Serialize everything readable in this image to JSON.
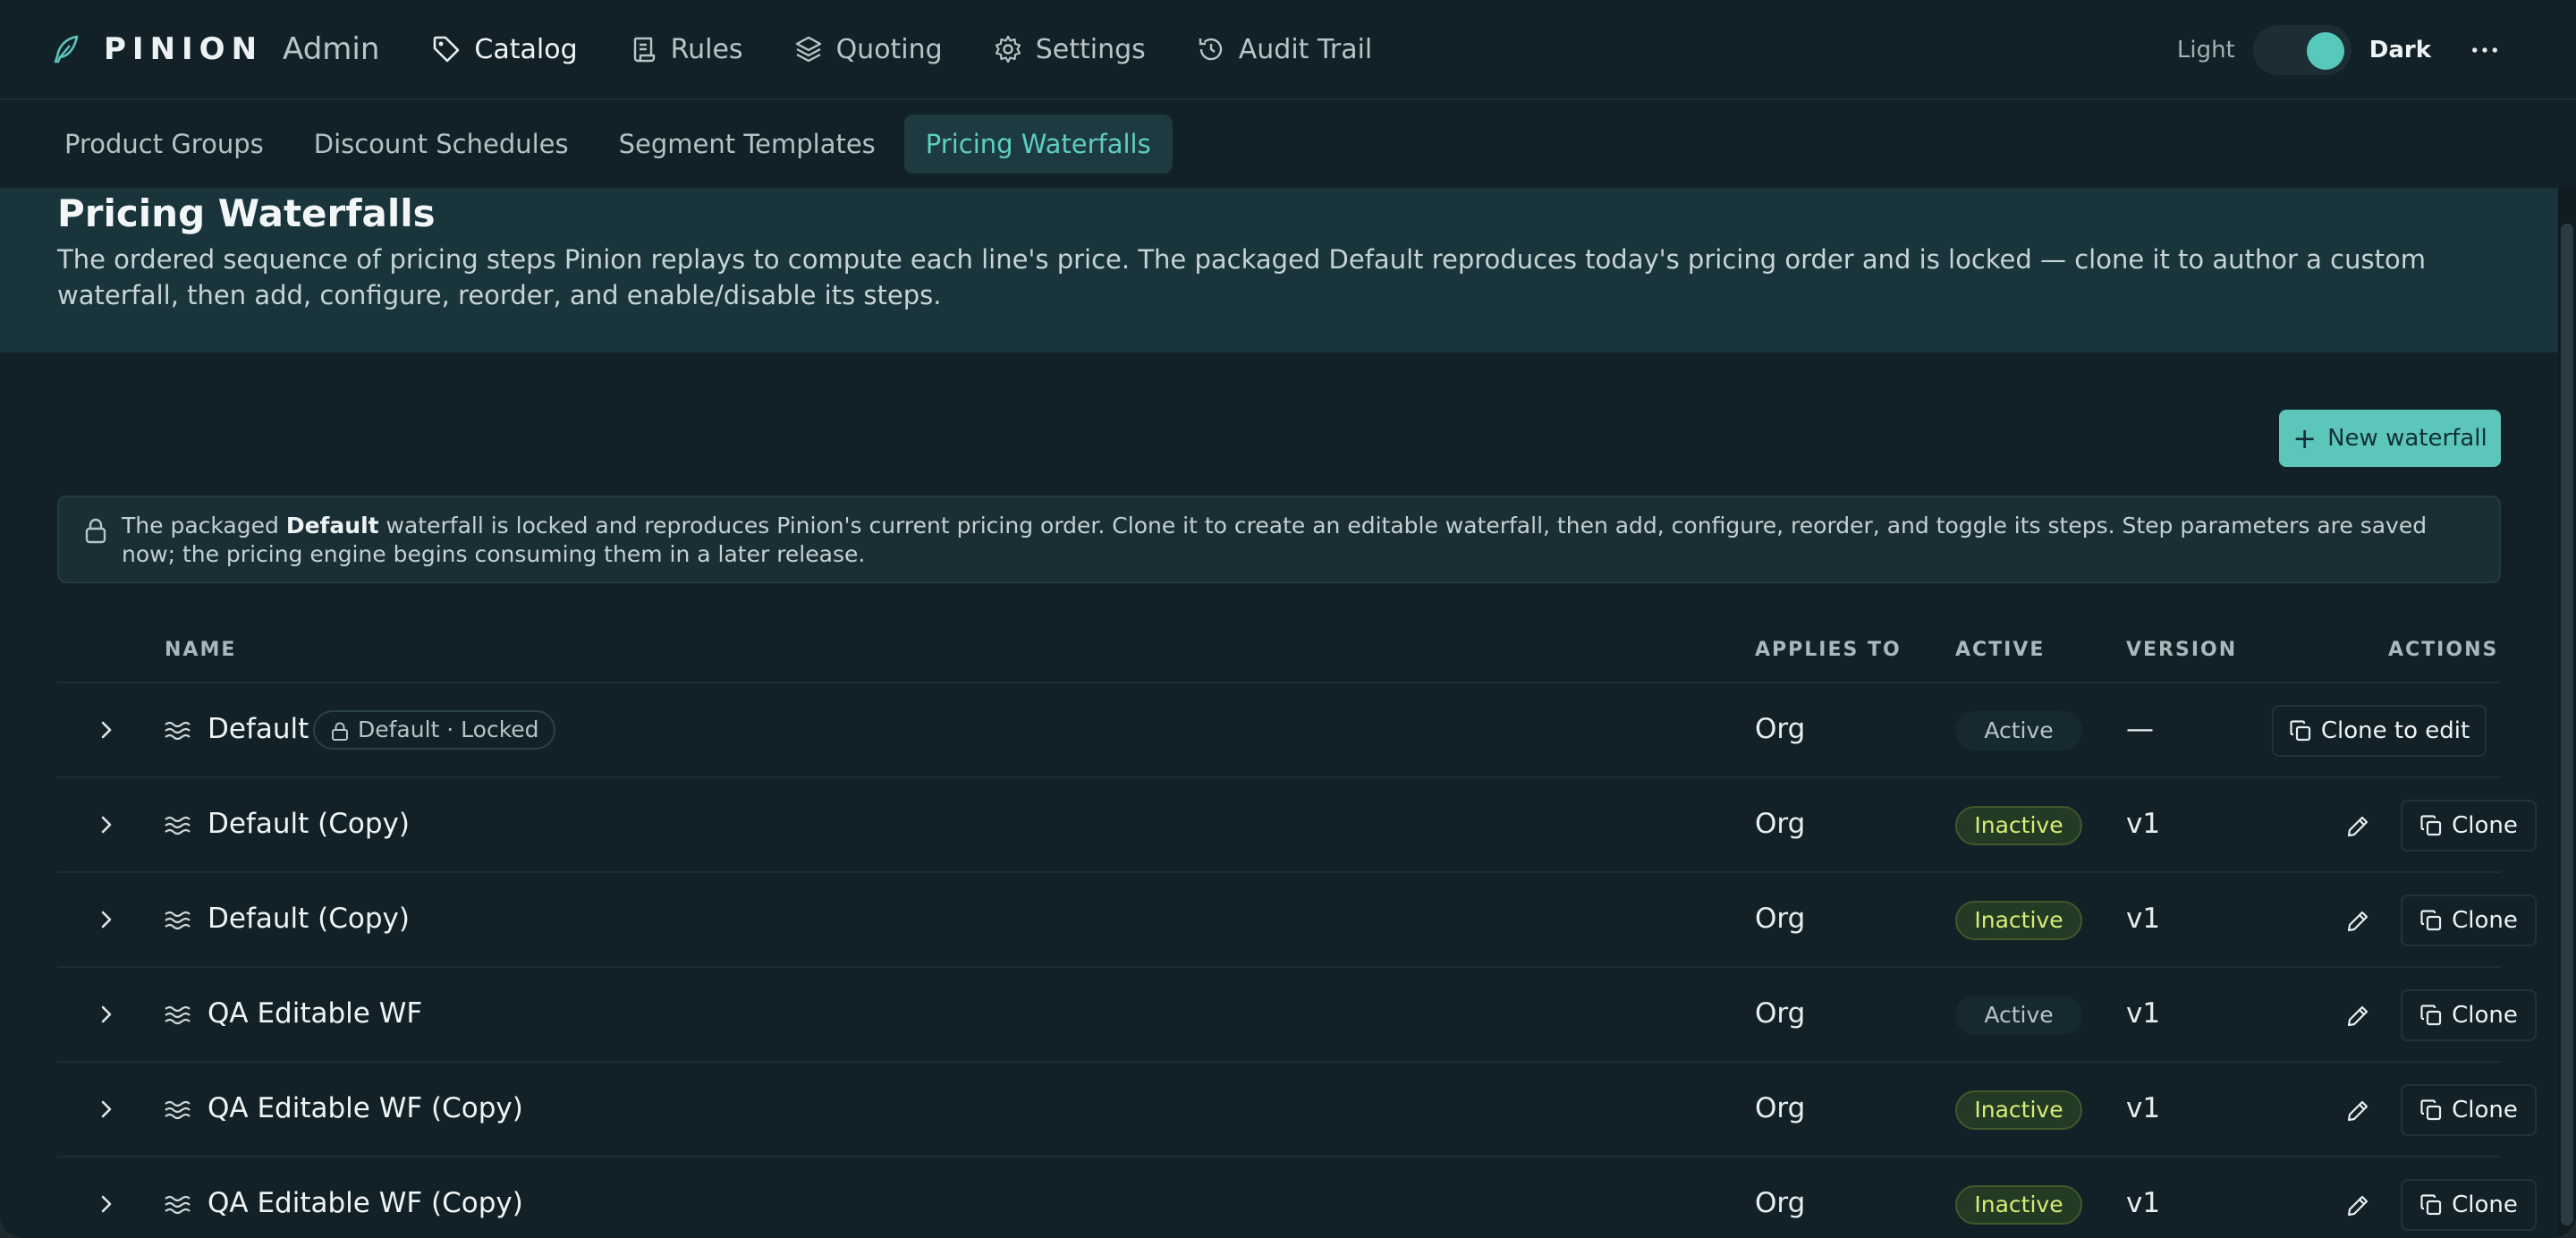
{
  "app": {
    "brand": "PINION",
    "brand_sub": "Admin",
    "nav": [
      {
        "label": "Catalog",
        "icon": "tag-icon",
        "active": true
      },
      {
        "label": "Rules",
        "icon": "scroll-icon"
      },
      {
        "label": "Quoting",
        "icon": "layers-icon"
      },
      {
        "label": "Settings",
        "icon": "gear-icon"
      },
      {
        "label": "Audit Trail",
        "icon": "history-icon"
      }
    ],
    "theme": {
      "light_label": "Light",
      "dark_label": "Dark",
      "selected": "Dark"
    }
  },
  "subtabs": [
    {
      "label": "Product Groups"
    },
    {
      "label": "Discount Schedules"
    },
    {
      "label": "Segment Templates"
    },
    {
      "label": "Pricing Waterfalls",
      "active": true
    }
  ],
  "page": {
    "title": "Pricing Waterfalls",
    "description": "The ordered sequence of pricing steps Pinion replays to compute each line's price. The packaged Default reproduces today's pricing order and is locked — clone it to author a custom waterfall, then add, configure, reorder, and enable/disable its steps.",
    "new_button": "New waterfall",
    "notice": {
      "before": "The packaged ",
      "bold": "Default",
      "after": " waterfall is locked and reproduces Pinion's current pricing order. Clone it to create an editable waterfall, then add, configure, reorder, and toggle its steps. Step parameters are saved now; the pricing engine begins consuming them in a later release."
    }
  },
  "table": {
    "headers": {
      "name": "NAME",
      "applies_to": "APPLIES TO",
      "active": "ACTIVE",
      "version": "VERSION",
      "actions": "ACTIONS"
    },
    "rows": [
      {
        "name": "Default",
        "badge": "Default · Locked",
        "applies_to": "Org",
        "status": "Active",
        "version": "—",
        "action": "Clone to edit",
        "locked": true
      },
      {
        "name": "Default (Copy)",
        "applies_to": "Org",
        "status": "Inactive",
        "version": "v1",
        "action": "Clone"
      },
      {
        "name": "Default (Copy)",
        "applies_to": "Org",
        "status": "Inactive",
        "version": "v1",
        "action": "Clone"
      },
      {
        "name": "QA Editable WF",
        "applies_to": "Org",
        "status": "Active",
        "version": "v1",
        "action": "Clone"
      },
      {
        "name": "QA Editable WF (Copy)",
        "applies_to": "Org",
        "status": "Inactive",
        "version": "v1",
        "action": "Clone"
      },
      {
        "name": "QA Editable WF (Copy)",
        "applies_to": "Org",
        "status": "Inactive",
        "version": "v1",
        "action": "Clone"
      }
    ]
  },
  "colors": {
    "accent": "#5cc6ba",
    "inactive_text": "#d6ef72",
    "background": "#122127"
  }
}
